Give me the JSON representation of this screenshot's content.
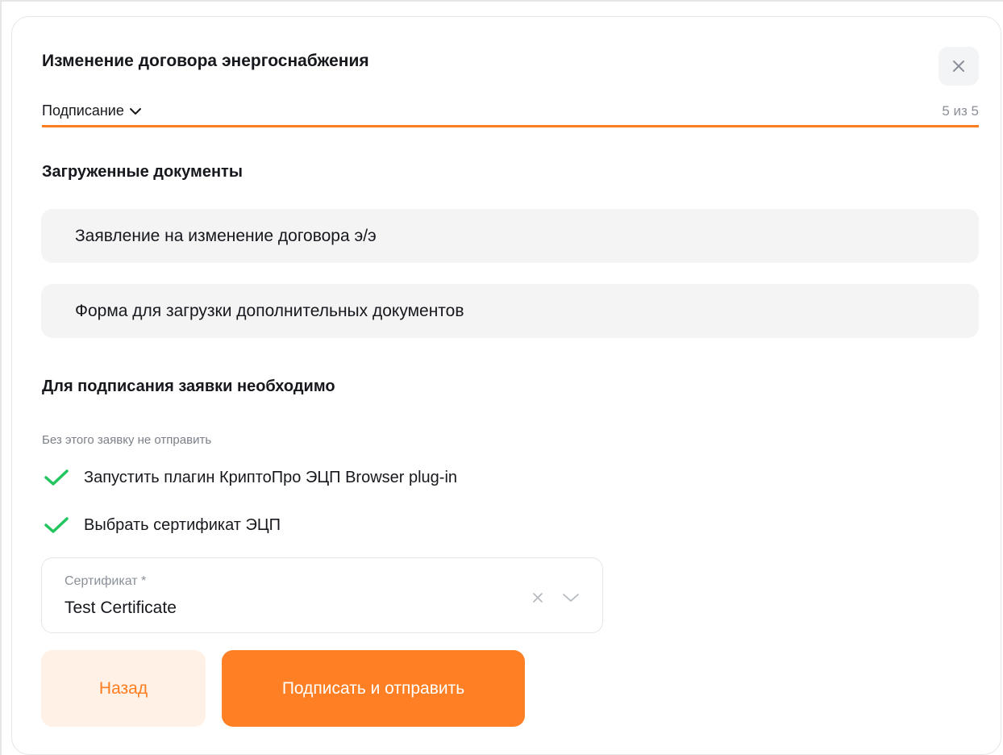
{
  "modal": {
    "title": "Изменение договора энергоснабжения",
    "close_icon": "close-icon"
  },
  "step": {
    "label": "Подписание",
    "counter": "5 из 5",
    "progress": 1.0,
    "accent_color": "#ff7c1f"
  },
  "uploaded_documents": {
    "heading": "Загруженные документы",
    "items": [
      {
        "label": "Заявление на изменение договора э/э"
      },
      {
        "label": "Форма для загрузки дополнительных документов"
      }
    ]
  },
  "signing_requirements": {
    "heading": "Для подписания заявки необходимо",
    "hint": "Без этого заявку не отправить",
    "items": [
      {
        "label": "Запустить плагин КриптоПро ЭЦП Browser plug-in",
        "done": true,
        "icon": "check-icon"
      },
      {
        "label": "Выбрать сертификат ЭЦП",
        "done": true,
        "icon": "check-icon"
      }
    ],
    "check_color": "#22c55e"
  },
  "certificate_field": {
    "label": "Сертификат *",
    "value": "Test Certificate"
  },
  "actions": {
    "back_label": "Назад",
    "submit_label": "Подписать и отправить"
  }
}
